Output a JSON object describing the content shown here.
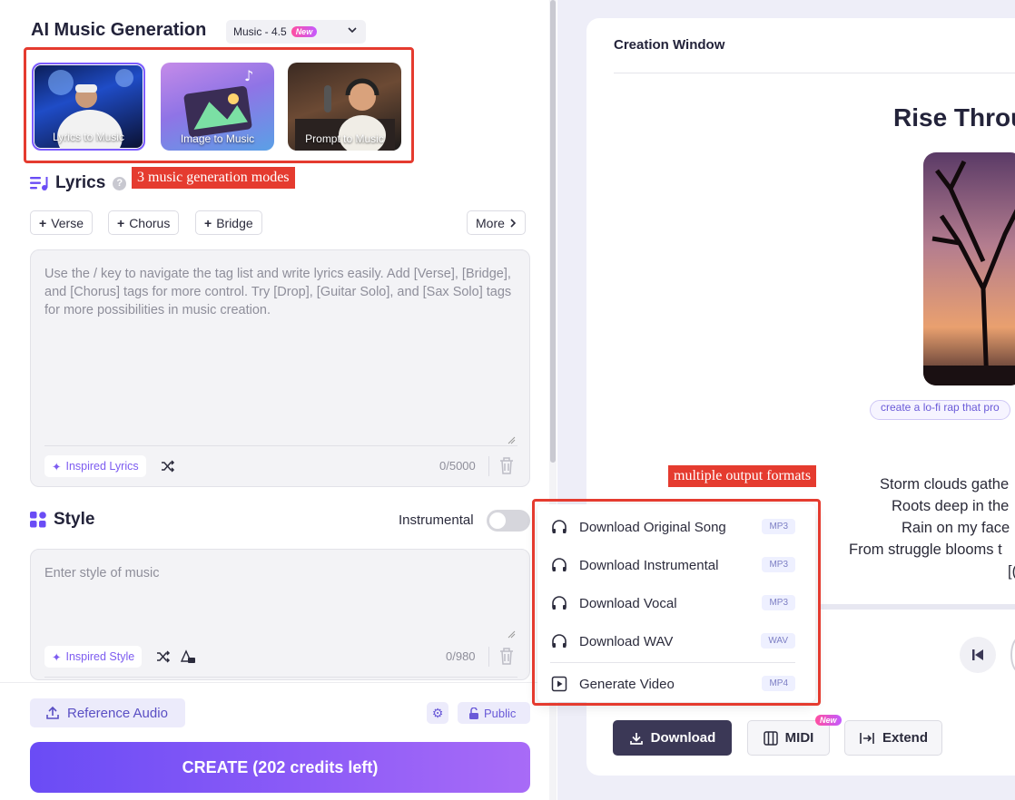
{
  "header": {
    "title": "AI Music Generation",
    "model": "Music - 4.5",
    "model_badge": "New"
  },
  "modes": [
    {
      "label": "Lyrics to Music",
      "selected": true
    },
    {
      "label": "Image to Music",
      "selected": false
    },
    {
      "label": "Prompt to Music",
      "selected": false
    }
  ],
  "annotations": {
    "modes_note": "3 music generation modes",
    "formats_note": "multiple output formats"
  },
  "lyrics": {
    "title": "Lyrics",
    "help": "?",
    "tags": [
      "Verse",
      "Chorus",
      "Bridge"
    ],
    "more_label": "More",
    "placeholder": "Use the / key to navigate the tag list and write lyrics easily. Add [Verse], [Bridge], and [Chorus] tags for more control. Try [Drop], [Guitar Solo], and [Sax Solo] tags for more possibilities in music creation.",
    "inspired_label": "Inspired Lyrics",
    "counter": "0/5000"
  },
  "style": {
    "title": "Style",
    "instrumental_label": "Instrumental",
    "instrumental_on": false,
    "placeholder": "Enter style of music",
    "inspired_label": "Inspired Style",
    "counter": "0/980"
  },
  "bottom": {
    "reference_label": "Reference Audio",
    "public_label": "Public",
    "create_label": "CREATE (202 credits left)"
  },
  "creation": {
    "title": "Creation Window",
    "song_title": "Rise Throu",
    "prompt_chip": "create a lo-fi rap that pro",
    "lyrics": [
      "Storm clouds gathe",
      "Roots deep in the",
      "Rain on my face",
      "From struggle blooms t",
      "[("
    ]
  },
  "download_menu": [
    {
      "label": "Download Original Song",
      "format": "MP3",
      "icon": "headphones-icon"
    },
    {
      "label": "Download Instrumental",
      "format": "MP3",
      "icon": "headphones-icon"
    },
    {
      "label": "Download Vocal",
      "format": "MP3",
      "icon": "headphones-icon"
    },
    {
      "label": "Download WAV",
      "format": "WAV",
      "icon": "headphones-icon"
    },
    {
      "label": "Generate Video",
      "format": "MP4",
      "icon": "video-play-icon"
    }
  ],
  "actions": {
    "download_label": "Download",
    "midi_label": "MIDI",
    "midi_badge": "New",
    "extend_label": "Extend"
  },
  "colors": {
    "accent": "#7c5cff",
    "annotation": "#e53b2f",
    "download_button": "#3b3856"
  }
}
